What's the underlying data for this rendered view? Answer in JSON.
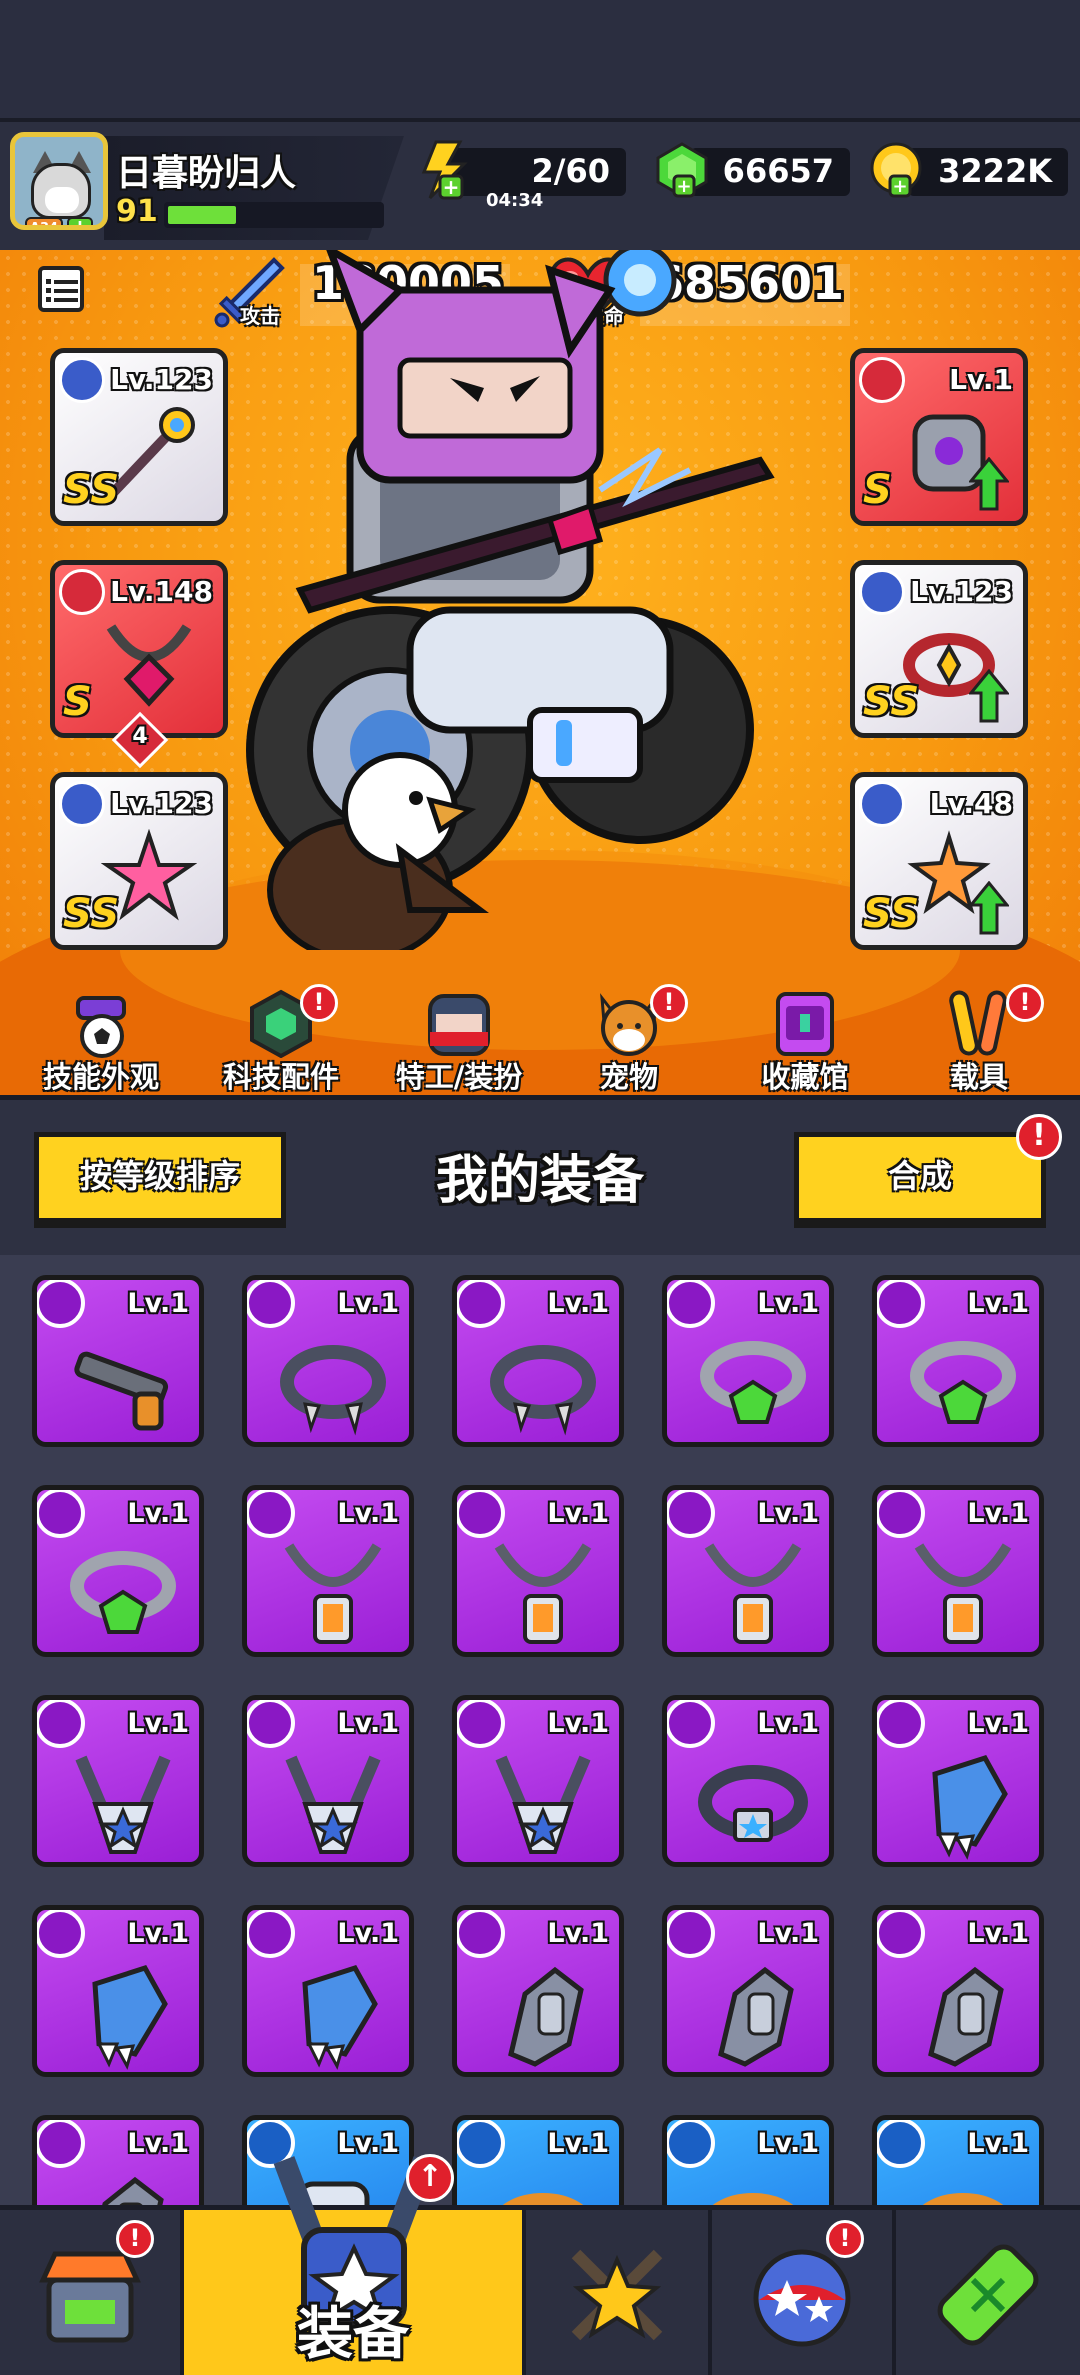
{
  "player": {
    "name": "日暮盼归人",
    "level": "91",
    "avatar_badge": "A34",
    "xp_fraction": 0.32
  },
  "resources": {
    "energy": "2/60",
    "energy_timer": "04:34",
    "gems": "66657",
    "gold": "3222K"
  },
  "stats": {
    "attack_value": "180005",
    "attack_label": "攻击",
    "hp_value": "685601",
    "hp_label": "生命"
  },
  "equipped": {
    "left": [
      {
        "level": "Lv.123",
        "rank": "SS",
        "slot": "weapon-icon"
      },
      {
        "level": "Lv.148",
        "rank": "S",
        "slot": "necklace-icon",
        "stars": "4"
      },
      {
        "level": "Lv.123",
        "rank": "SS",
        "slot": "glove-icon"
      }
    ],
    "right": [
      {
        "level": "Lv.1",
        "rank": "S",
        "slot": "armor-icon"
      },
      {
        "level": "Lv.123",
        "rank": "SS",
        "slot": "belt-icon"
      },
      {
        "level": "Lv.48",
        "rank": "SS",
        "slot": "boot-icon"
      }
    ]
  },
  "features": [
    {
      "label": "技能外观",
      "alert": ""
    },
    {
      "label": "科技配件",
      "alert": "!"
    },
    {
      "label": "特工/装扮",
      "alert": ""
    },
    {
      "label": "宠物",
      "alert": "!"
    },
    {
      "label": "收藏馆",
      "alert": ""
    },
    {
      "label": "载具",
      "alert": "!"
    }
  ],
  "equipment_panel": {
    "sort_label": "按等级排序",
    "title": "我的装备",
    "merge_label": "合成",
    "merge_alert": "!"
  },
  "inventory": [
    {
      "level": "Lv.1",
      "type": "weapon"
    },
    {
      "level": "Lv.1",
      "type": "spiked-collar"
    },
    {
      "level": "Lv.1",
      "type": "spiked-collar"
    },
    {
      "level": "Lv.1",
      "type": "gem-ring"
    },
    {
      "level": "Lv.1",
      "type": "gem-ring"
    },
    {
      "level": "Lv.1",
      "type": "gem-ring"
    },
    {
      "level": "Lv.1",
      "type": "chain-necklace"
    },
    {
      "level": "Lv.1",
      "type": "chain-necklace"
    },
    {
      "level": "Lv.1",
      "type": "chain-necklace"
    },
    {
      "level": "Lv.1",
      "type": "chain-necklace"
    },
    {
      "level": "Lv.1",
      "type": "star-necklace"
    },
    {
      "level": "Lv.1",
      "type": "star-necklace"
    },
    {
      "level": "Lv.1",
      "type": "star-necklace"
    },
    {
      "level": "Lv.1",
      "type": "star-belt"
    },
    {
      "level": "Lv.1",
      "type": "fur-glove"
    },
    {
      "level": "Lv.1",
      "type": "fur-glove"
    },
    {
      "level": "Lv.1",
      "type": "fur-glove"
    },
    {
      "level": "Lv.1",
      "type": "armor-glove"
    },
    {
      "level": "Lv.1",
      "type": "armor-glove"
    },
    {
      "level": "Lv.1",
      "type": "armor-glove"
    },
    {
      "level": "Lv.1",
      "type": "armor-glove"
    },
    {
      "level": "Lv.1",
      "type": "armor"
    },
    {
      "level": "Lv.1",
      "type": "ring"
    },
    {
      "level": "Lv.1",
      "type": "ring"
    },
    {
      "level": "Lv.1",
      "type": "ring"
    }
  ],
  "bottom_nav": {
    "shop_alert": "!",
    "equip_label": "装备",
    "equip_alert": "↑",
    "pvp_alert": "!"
  },
  "colors": {
    "hero_bg": "#f89a10",
    "epic": "#9a1fd6",
    "rare": "#1e78e8",
    "accent_yellow": "#ffd21f",
    "alert_red": "#e0202c"
  }
}
